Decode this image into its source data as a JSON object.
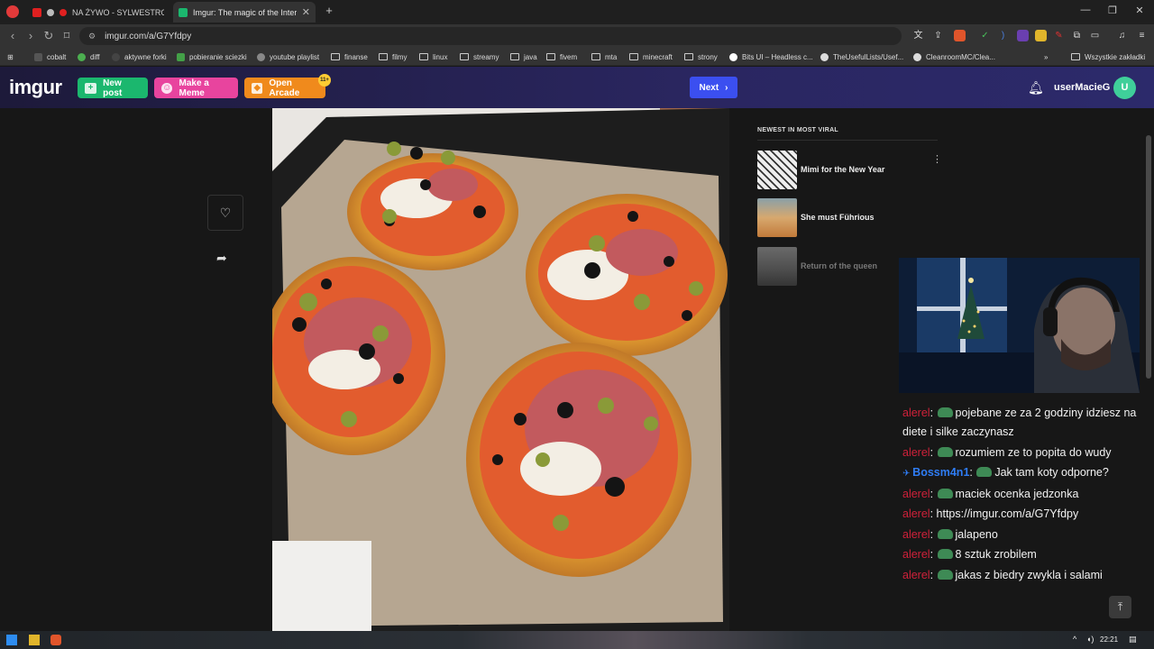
{
  "browser": {
    "tabs": [
      {
        "label": "NA ŻYWO - SYLWESTROWE",
        "active": false
      },
      {
        "label": "Imgur: The magic of the Internet",
        "active": true
      }
    ],
    "url": "imgur.com/a/G7Yfdpy",
    "bookmarks": [
      "cobalt",
      "diff",
      "aktywne forki",
      "pobieranie sciezki",
      "youtube playlist",
      "finanse",
      "filmy",
      "linux",
      "streamy",
      "java",
      "fivem",
      "mta",
      "minecraft",
      "strony",
      "Bits UI – Headless c...",
      "TheUsefulLists/Usef...",
      "CleanroomMC/Clea...",
      "Wszystkie zakładki"
    ]
  },
  "header": {
    "logo": "imgur",
    "new_post": "New post",
    "make_meme": "Make a Meme",
    "open_arcade": "Open Arcade",
    "arcade_badge": "11+",
    "next": "Next",
    "username": "userMacieG",
    "avatar_letter": "U"
  },
  "sidebar": {
    "title": "NEWEST IN MOST VIRAL",
    "items": [
      {
        "label": "Mimi for the New Year"
      },
      {
        "label": "She must Führious"
      },
      {
        "label": "Return of the queen"
      }
    ]
  },
  "chat": [
    {
      "user": "alerel",
      "emote": true,
      "text": "pojebane ze za 2 godziny idziesz na diete i silke zaczynasz"
    },
    {
      "user": "alerel",
      "emote": true,
      "text": "rozumiem ze to popita do wudy"
    },
    {
      "user": "Bossm4n1",
      "emote": true,
      "text": "Jak tam koty odporne?",
      "blue": true
    },
    {
      "user": "alerel",
      "emote": true,
      "text": "maciek ocenka jedzonka"
    },
    {
      "user": "alerel",
      "emote": false,
      "text": "https://imgur.com/a/G7Yfdpy"
    },
    {
      "user": "alerel",
      "emote": true,
      "text": "jalapeno"
    },
    {
      "user": "alerel",
      "emote": true,
      "text": "8 sztuk zrobilem"
    },
    {
      "user": "alerel",
      "emote": true,
      "text": "jakas z biedry zwykla i salami"
    }
  ],
  "taskbar": {
    "time": "22:21"
  },
  "colors": {
    "new_post": "#1bb76e",
    "make_meme": "#e8449e",
    "open_arcade": "#f08a1c",
    "next": "#3b4ff0",
    "chat_user": "#d0213a"
  }
}
